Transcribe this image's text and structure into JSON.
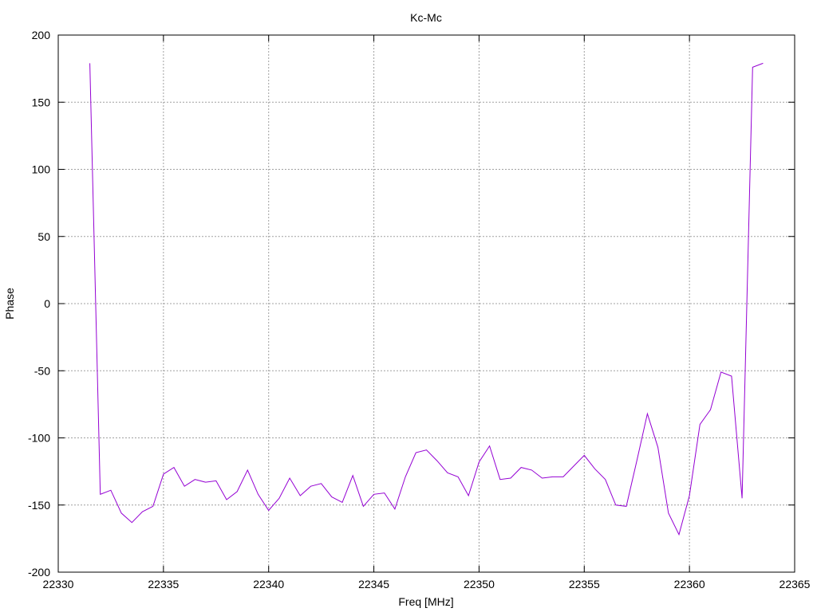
{
  "chart_data": {
    "type": "line",
    "title": "Kc-Mc",
    "xlabel": "Freq [MHz]",
    "ylabel": "Phase",
    "xlim": [
      22330,
      22365
    ],
    "ylim": [
      -200,
      200
    ],
    "grid": true,
    "x_ticks": [
      "22330",
      "22335",
      "22340",
      "22345",
      "22350",
      "22355",
      "22360",
      "22365"
    ],
    "y_ticks": [
      "200",
      "150",
      "100",
      "50",
      "0",
      "-50",
      "-100",
      "-150",
      "-200"
    ],
    "colors": {
      "series": "#9400d3",
      "grid": "#a0a0a0",
      "axis": "#000000"
    },
    "series": [
      {
        "x": [
          22331.5,
          22332.0,
          22332.5,
          22333.0,
          22333.5,
          22334.0,
          22334.5,
          22335.0,
          22335.5,
          22336.0,
          22336.5,
          22337.0,
          22337.5,
          22338.0,
          22338.5,
          22339.0,
          22339.5,
          22340.0,
          22340.5,
          22341.0,
          22341.5,
          22342.0,
          22342.5,
          22343.0,
          22343.5,
          22344.0,
          22344.5,
          22345.0,
          22345.5,
          22346.0,
          22346.5,
          22347.0,
          22347.5,
          22348.0,
          22348.5,
          22349.0,
          22349.5,
          22350.0,
          22350.5,
          22351.0,
          22351.5,
          22352.0,
          22352.5,
          22353.0,
          22353.5,
          22354.0,
          22354.5,
          22355.0,
          22355.5,
          22356.0,
          22356.5,
          22357.0,
          22357.5,
          22358.0,
          22358.5,
          22359.0,
          22359.5,
          22360.0,
          22360.5,
          22361.0,
          22361.5,
          22362.0,
          22362.5,
          22363.0,
          22363.5
        ],
        "values": [
          179,
          -142,
          -139,
          -156,
          -163,
          -155,
          -151,
          -127,
          -122,
          -136,
          -131,
          -133,
          -132,
          -146,
          -140,
          -124,
          -142,
          -154,
          -145,
          -130,
          -143,
          -136,
          -134,
          -144,
          -148,
          -128,
          -151,
          -142,
          -141,
          -153,
          -129,
          -111,
          -109,
          -117,
          -126,
          -129,
          -143,
          -118,
          -106,
          -131,
          -130,
          -122,
          -124,
          -130,
          -129,
          -129,
          -121,
          -113,
          -123,
          -131,
          -150,
          -151,
          -117,
          -82,
          -107,
          -156,
          -172,
          -143,
          -90,
          -79,
          -51,
          -54,
          -145,
          176,
          179
        ]
      }
    ]
  }
}
